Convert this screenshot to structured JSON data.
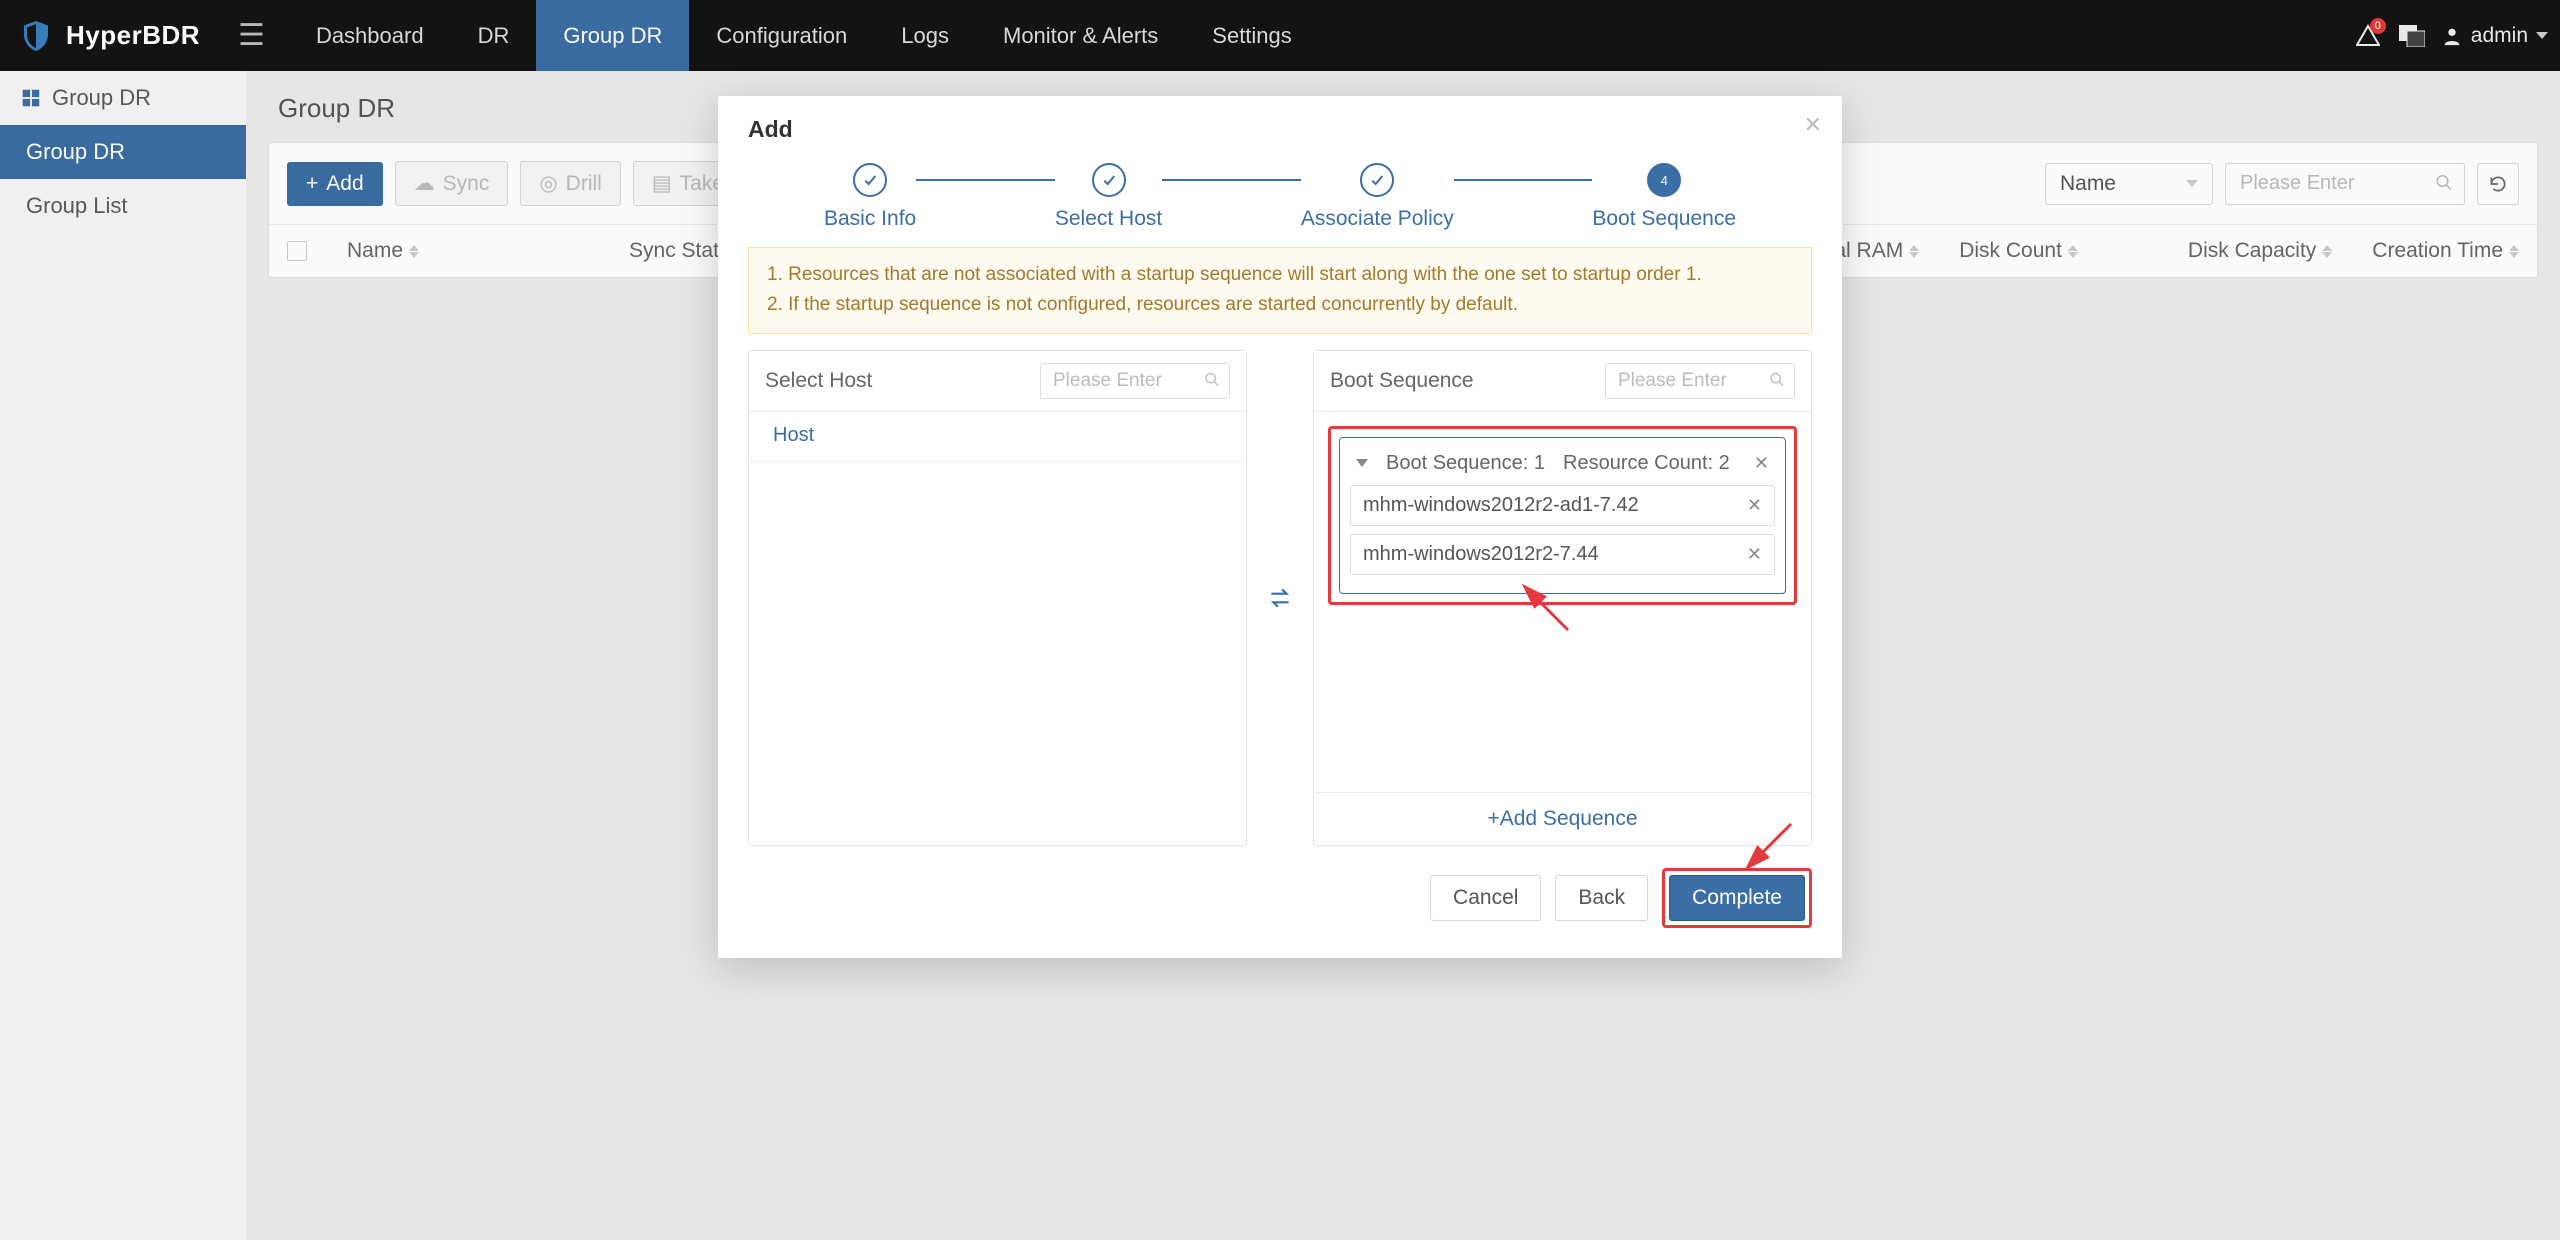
{
  "brand": {
    "name": "HyperBDR"
  },
  "topnav": {
    "items": [
      "Dashboard",
      "DR",
      "Group DR",
      "Configuration",
      "Logs",
      "Monitor & Alerts",
      "Settings"
    ],
    "active": "Group DR",
    "notifications": "0",
    "user": "admin"
  },
  "sidebar": {
    "title": "Group DR",
    "items": [
      "Group DR",
      "Group List"
    ],
    "active": "Group DR"
  },
  "page": {
    "title": "Group DR",
    "toolbar": {
      "add": "Add",
      "sync": "Sync",
      "drill": "Drill",
      "takeover": "Takeover"
    },
    "filter": {
      "field": "Name",
      "placeholder": "Please Enter"
    },
    "columns": [
      "Name",
      "Sync Status",
      "tal RAM",
      "Disk Count",
      "Disk Capacity",
      "Creation Time"
    ]
  },
  "modal": {
    "title": "Add",
    "steps": [
      "Basic Info",
      "Select Host",
      "Associate Policy",
      "Boot Sequence"
    ],
    "active_step": 4,
    "alert_lines": [
      "1. Resources that are not associated with a startup sequence will start along with the one set to startup order 1.",
      "2. If the startup sequence is not configured, resources are started concurrently by default."
    ],
    "left_panel": {
      "title": "Select Host",
      "search_placeholder": "Please Enter",
      "tab": "Host"
    },
    "right_panel": {
      "title": "Boot Sequence",
      "search_placeholder": "Please Enter",
      "sequence": {
        "header_seq": "Boot Sequence: 1",
        "header_count": "Resource Count: 2",
        "resources": [
          "mhm-windows2012r2-ad1-7.42",
          "mhm-windows2012r2-7.44"
        ]
      },
      "add_sequence": "Add Sequence"
    },
    "actions": {
      "cancel": "Cancel",
      "back": "Back",
      "complete": "Complete"
    }
  }
}
